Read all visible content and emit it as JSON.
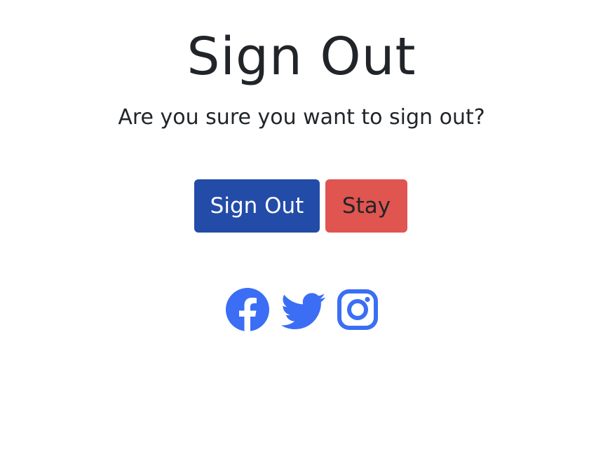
{
  "page": {
    "title": "Sign Out",
    "subtitle": "Are you sure you want to sign out?"
  },
  "buttons": {
    "sign_out_label": "Sign Out",
    "stay_label": "Stay"
  },
  "social": {
    "icons": [
      "facebook-icon",
      "twitter-icon",
      "instagram-icon"
    ],
    "color": "#3b6ef5"
  },
  "colors": {
    "sign_out_button": "#234ba8",
    "stay_button": "#e05550",
    "text": "#212529"
  }
}
